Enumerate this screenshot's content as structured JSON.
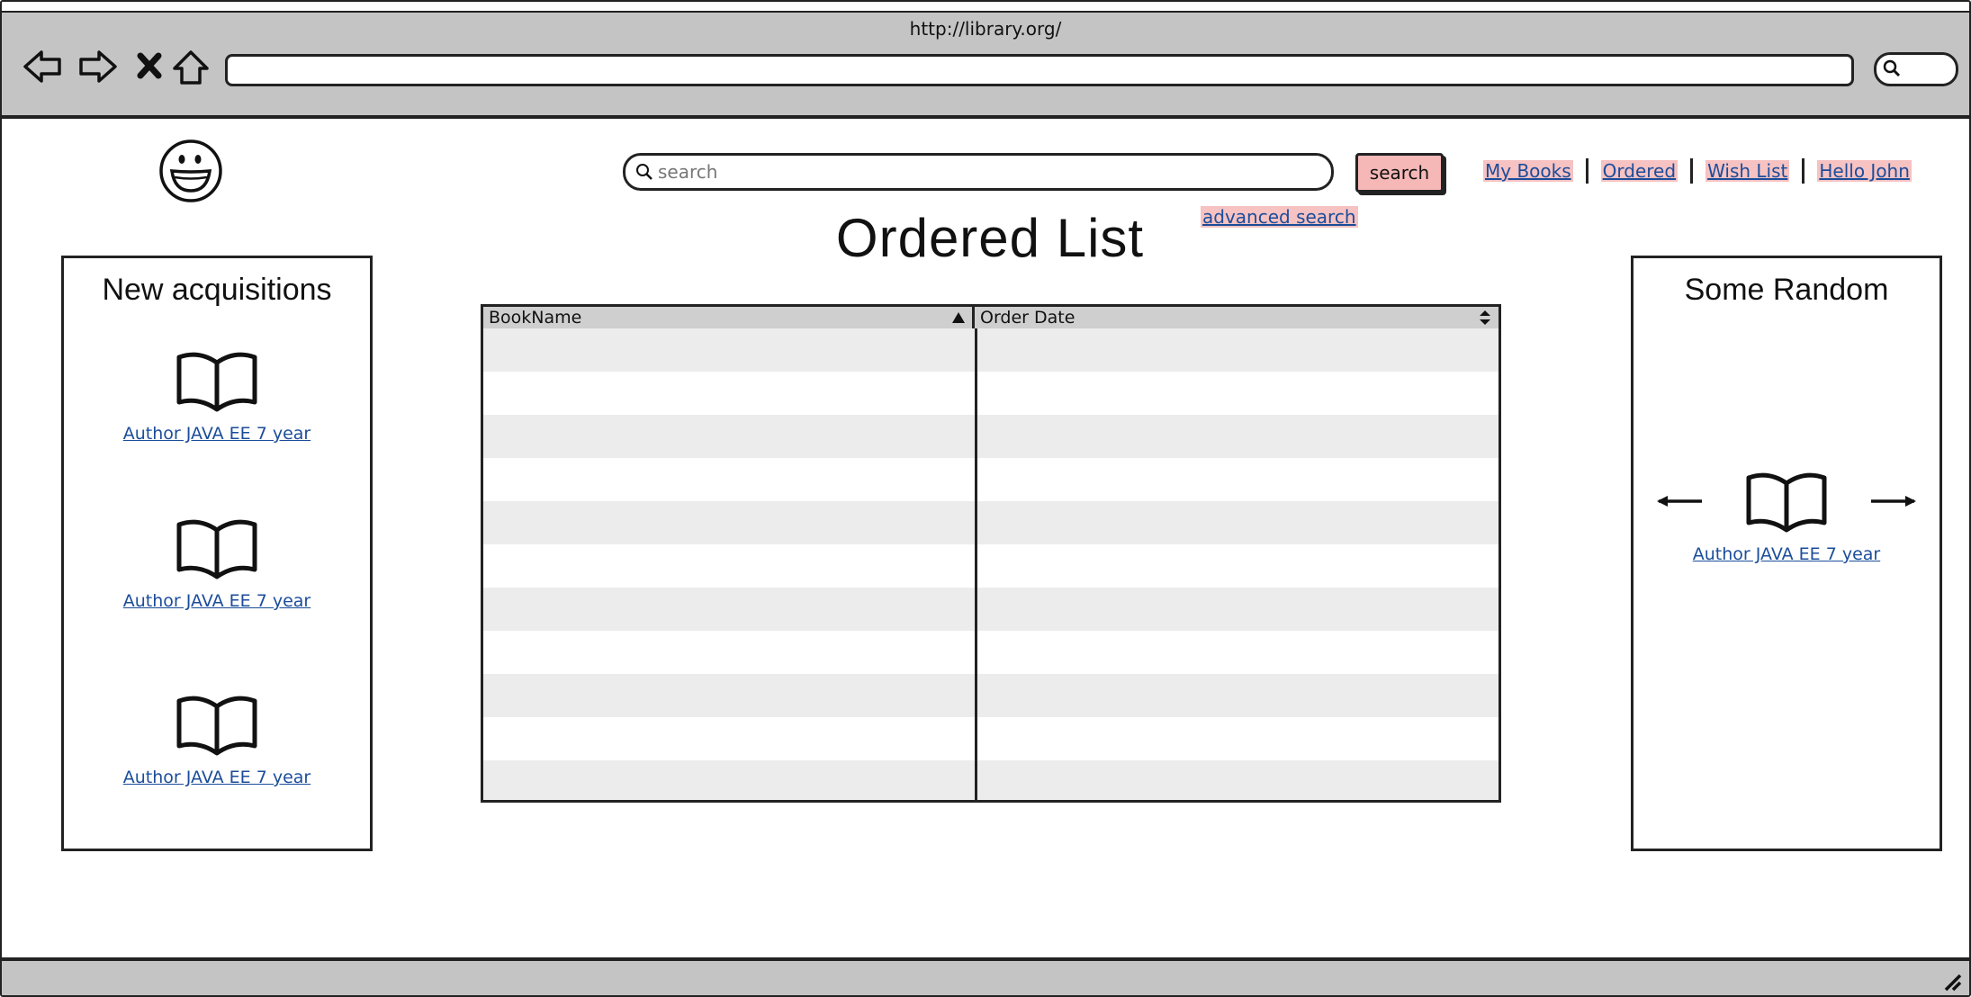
{
  "browser": {
    "url": "http://library.org/",
    "nav_icons": [
      "back-icon",
      "forward-icon",
      "stop-icon",
      "home-icon"
    ],
    "search_icon": "search-icon"
  },
  "header": {
    "logo_icon": "smiley-logo-icon",
    "search_placeholder": "search",
    "search_button": "search",
    "advanced_search": "advanced search",
    "links": [
      "My Books",
      "Ordered",
      "Wish List",
      "Hello John"
    ]
  },
  "main": {
    "title": "Ordered List",
    "table": {
      "columns": [
        {
          "label": "BookName",
          "sort": "ascending"
        },
        {
          "label": "Order Date",
          "sort": "none"
        }
      ],
      "rows": [
        [
          "",
          ""
        ],
        [
          "",
          ""
        ],
        [
          "",
          ""
        ],
        [
          "",
          ""
        ],
        [
          "",
          ""
        ],
        [
          "",
          ""
        ],
        [
          "",
          ""
        ],
        [
          "",
          ""
        ],
        [
          "",
          ""
        ],
        [
          "",
          ""
        ],
        [
          "",
          ""
        ]
      ]
    }
  },
  "left_panel": {
    "title": "New acquisitions",
    "items": [
      {
        "icon": "book-icon",
        "label": "Author JAVA EE 7 year"
      },
      {
        "icon": "book-icon",
        "label": "Author JAVA EE 7 year"
      },
      {
        "icon": "book-icon",
        "label": "Author JAVA EE 7 year"
      }
    ]
  },
  "right_panel": {
    "title": "Some Random",
    "item": {
      "icon": "book-icon",
      "label": "Author JAVA EE 7 year"
    },
    "arrows": [
      "left-arrow-icon",
      "right-arrow-icon"
    ]
  },
  "colors": {
    "chrome": "#c4c4c4",
    "link": "#1b4d9a",
    "highlight": "#f6c2c2",
    "button": "#f6b7b7",
    "row_alt": "#ececec",
    "header_row": "#cfcfcf"
  }
}
